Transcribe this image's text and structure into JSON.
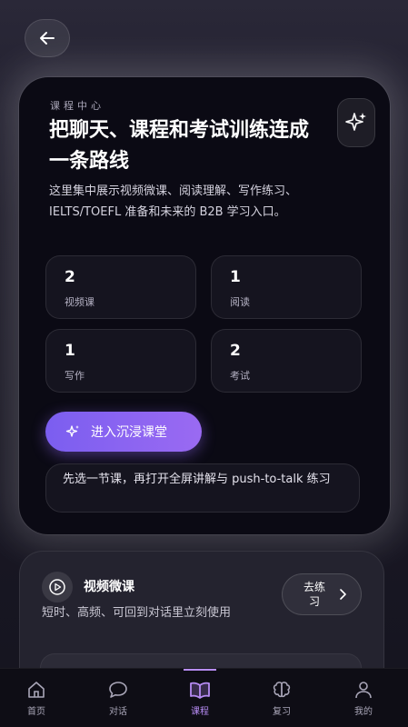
{
  "back_button": {
    "icon": "arrow-left-icon"
  },
  "hero": {
    "eyebrow": "课程中心",
    "title": "把聊天、课程和考试训练连成一条路线",
    "description": "这里集中展示视频微课、阅读理解、写作练习、IELTS/TOEFL 准备和未来的 B2B 学习入口。",
    "stats": [
      {
        "value": "2",
        "label": "视频课"
      },
      {
        "value": "1",
        "label": "阅读"
      },
      {
        "value": "1",
        "label": "写作"
      },
      {
        "value": "2",
        "label": "考试"
      }
    ],
    "cta_label": "进入沉浸课堂",
    "hint": "先选一节课，再打开全屏讲解与 push-to-talk 练习"
  },
  "video_card": {
    "title": "视频微课",
    "description": "短时、高频、可回到对话里立刻使用",
    "practice_label": "去练习"
  },
  "tabbar": {
    "tabs": [
      {
        "label": "首页",
        "icon": "home-icon"
      },
      {
        "label": "对话",
        "icon": "chat-bubble-icon"
      },
      {
        "label": "课程",
        "icon": "book-icon",
        "active": true
      },
      {
        "label": "复习",
        "icon": "brain-icon"
      },
      {
        "label": "我的",
        "icon": "user-icon"
      }
    ]
  },
  "colors": {
    "accent": "#8b63f0",
    "active_tab": "#b78cf4",
    "card_bg": "#0b0a14"
  }
}
